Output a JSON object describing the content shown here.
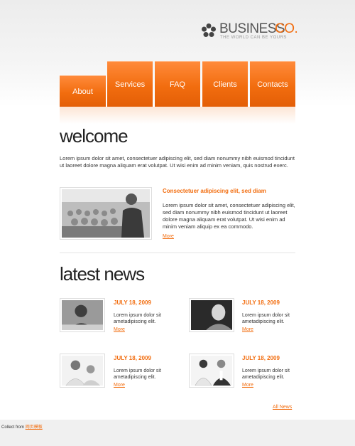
{
  "brand": {
    "name_main": "BUSINESS",
    "name_accent": "CO.",
    "slogan": "THE WORLD CAN BE YOURS",
    "accent_color": "#f26d0f"
  },
  "nav": {
    "items": [
      {
        "label": "About",
        "active": true
      },
      {
        "label": "Services"
      },
      {
        "label": "FAQ"
      },
      {
        "label": "Clients"
      },
      {
        "label": "Contacts"
      }
    ]
  },
  "welcome": {
    "title": "welcome",
    "intro": "Lorem ipsum dolor sit amet, consectetuer adipiscing elit, sed diam nonummy nibh euismod tincidunt ut laoreet dolore magna aliquam erat volutpat. Ut wisi enim ad minim veniam, quis nostrud exerc.",
    "feature": {
      "title": "Consectetuer adipiscing elit, sed diam",
      "text": "Lorem ipsum dolor sit amet, consectetuer adipiscing elit, sed diam nonummy nibh euismod tincidunt ut laoreet dolore magna aliquam erat volutpat. Ut wisi enim ad minim veniam aliquip ex ea commodo.",
      "more": "More"
    }
  },
  "news": {
    "title": "latest news",
    "items": [
      {
        "date": "JULY 18, 2009",
        "text": "Lorem ipsum dolor sit ametadipiscing elit.",
        "more": "More"
      },
      {
        "date": "JULY 18, 2009",
        "text": "Lorem ipsum dolor sit ametadipiscing elit.",
        "more": "More"
      },
      {
        "date": "JULY 18, 2009",
        "text": "Lorem ipsum dolor sit ametadipiscing elit.",
        "more": "More"
      },
      {
        "date": "JULY 18, 2009",
        "text": "Lorem ipsum dolor sit ametadipiscing elit.",
        "more": "More"
      }
    ],
    "all_news": "All News"
  },
  "footer": {
    "prefix": "Collect from",
    "link": "网页模板"
  }
}
